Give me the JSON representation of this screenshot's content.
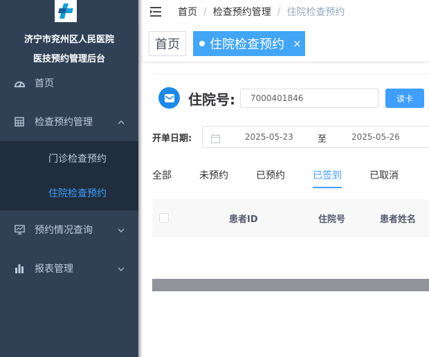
{
  "sidebar": {
    "hospital_line1": "济宁市兖州区人民医院",
    "hospital_line2": "医技预约管理后台",
    "items": [
      {
        "label": "首页",
        "icon": "dashboard-icon"
      },
      {
        "label": "检查预约管理",
        "icon": "table-icon",
        "expanded": true
      },
      {
        "label": "预约情况查询",
        "icon": "monitor-icon"
      },
      {
        "label": "报表管理",
        "icon": "bar-chart-icon"
      }
    ],
    "subitems": [
      {
        "label": "门诊检查预约"
      },
      {
        "label": "住院检查预约",
        "active": true
      }
    ]
  },
  "navbar": {
    "breadcrumb": [
      "首页",
      "检查预约管理",
      "住院检查预约"
    ],
    "separator": "/"
  },
  "tags": {
    "home": "首页",
    "active": "住院检查预约",
    "close": "×"
  },
  "form": {
    "inpatient_label": "住院号:",
    "inpatient_value": "7000401846",
    "read_card": "读卡",
    "date_label": "开单日期:",
    "date_start": "2025-05-23",
    "date_sep": "至",
    "date_end": "2025-05-26"
  },
  "status_tabs": [
    "全部",
    "未预约",
    "已预约",
    "已签到",
    "已取消"
  ],
  "active_status_tab": "已签到",
  "table": {
    "headers": [
      "患者ID",
      "住院号",
      "患者姓名"
    ]
  },
  "colors": {
    "sidebar_bg": "#304156",
    "submenu_bg": "#1f2d3d",
    "accent": "#409eff",
    "active_tag": "#42a5f5"
  }
}
